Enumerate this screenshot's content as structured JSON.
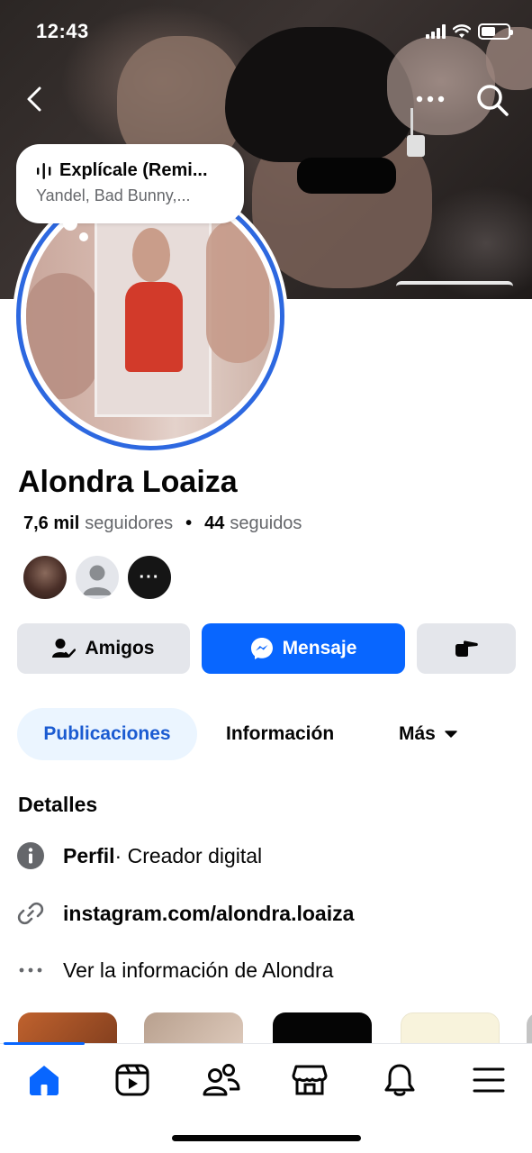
{
  "status_bar": {
    "time": "12:43"
  },
  "note": {
    "title": "Explícale (Remi...",
    "subtitle": "Yandel, Bad Bunny,..."
  },
  "profile": {
    "name": "Alondra Loaiza",
    "followers_count": "7,6 mil",
    "followers_label": "seguidores",
    "separator": "•",
    "following_count": "44",
    "following_label": "seguidos",
    "mutual_more": "···"
  },
  "actions": {
    "friends_label": "Amigos",
    "message_label": "Mensaje"
  },
  "tabs": [
    {
      "label": "Publicaciones",
      "active": true
    },
    {
      "label": "Información",
      "active": false
    },
    {
      "label": "Más",
      "active": false
    }
  ],
  "details": {
    "title": "Detalles",
    "profile_label": "Perfil",
    "profile_value": " · Creador digital",
    "link": "instagram.com/alondra.loaiza",
    "see_info": "Ver la información de Alondra"
  },
  "bottom_nav": {
    "items": [
      {
        "icon": "home-icon",
        "active": true
      },
      {
        "icon": "video-icon",
        "active": false
      },
      {
        "icon": "friends-icon",
        "active": false
      },
      {
        "icon": "marketplace-icon",
        "active": false
      },
      {
        "icon": "bell-icon",
        "active": false
      },
      {
        "icon": "menu-icon",
        "active": false
      }
    ]
  },
  "colors": {
    "accent": "#0866ff",
    "tab_active_bg": "#ebf5ff",
    "tab_active_text": "#1b5bd1",
    "secondary_button": "#e4e6eb",
    "muted_text": "#65676b",
    "story_ring": "#2d68e0"
  }
}
